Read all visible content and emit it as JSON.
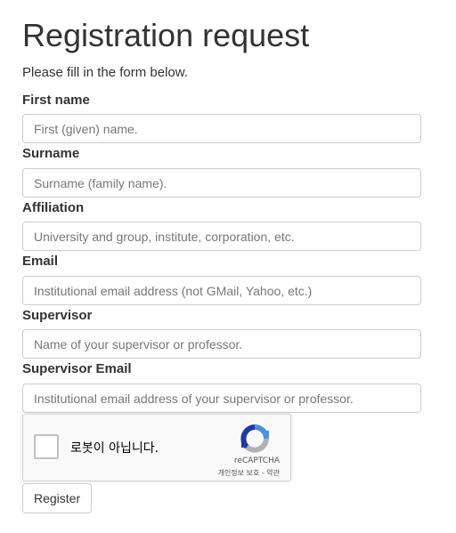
{
  "page": {
    "title": "Registration request",
    "intro": "Please fill in the form below."
  },
  "form": {
    "fields": [
      {
        "label": "First name",
        "placeholder": "First (given) name.",
        "value": ""
      },
      {
        "label": "Surname",
        "placeholder": "Surname (family name).",
        "value": ""
      },
      {
        "label": "Affiliation",
        "placeholder": "University and group, institute, corporation, etc.",
        "value": ""
      },
      {
        "label": "Email",
        "placeholder": "Institutional email address (not GMail, Yahoo, etc.)",
        "value": ""
      },
      {
        "label": "Supervisor",
        "placeholder": "Name of your supervisor or professor.",
        "value": ""
      },
      {
        "label": "Supervisor Email",
        "placeholder": "Institutional email address of your supervisor or professor.",
        "value": ""
      }
    ],
    "submit_label": "Register"
  },
  "recaptcha": {
    "checkbox_label": "로봇이 아닙니다.",
    "brand": "reCAPTCHA",
    "privacy_link": "개인정보 보호",
    "separator": " - ",
    "terms_link": "약관",
    "logo_icon": "recaptcha-logo-icon",
    "colors": {
      "blue": "#1c3aa9",
      "light_blue": "#4a90e2",
      "grey": "#b2b2b2"
    }
  }
}
